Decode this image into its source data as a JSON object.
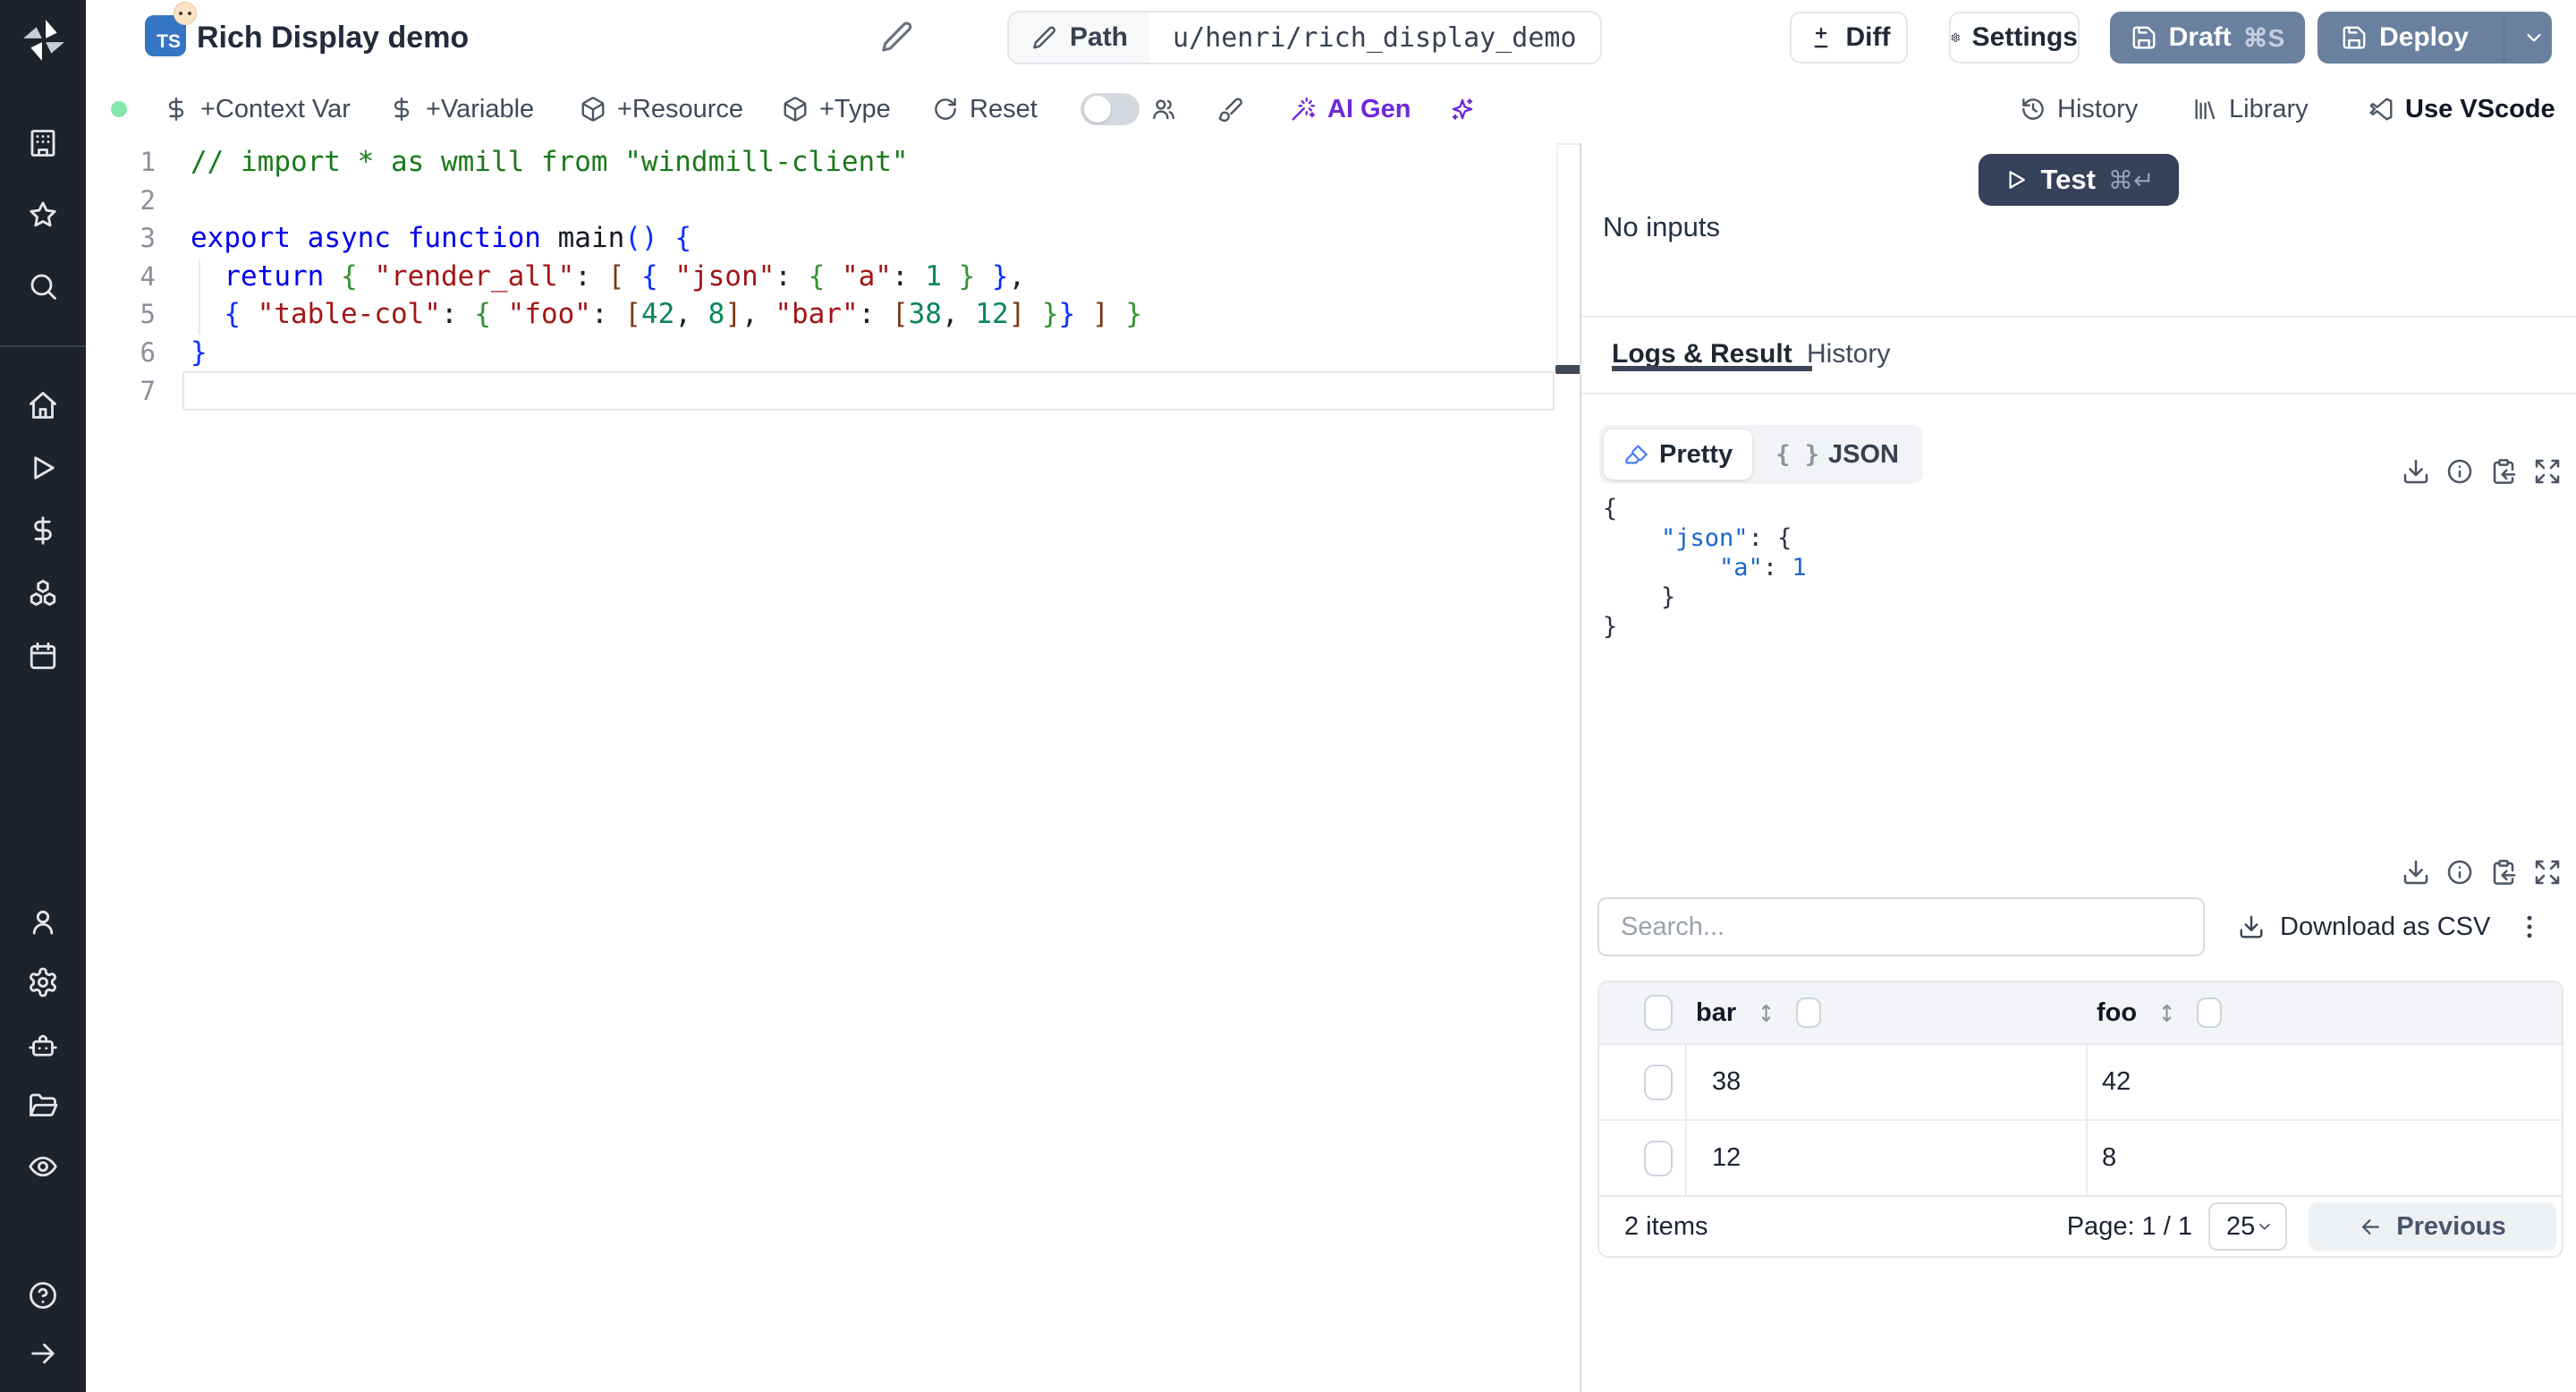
{
  "sidebar": {
    "icons": [
      "windmill-logo",
      "building",
      "star",
      "search",
      "home",
      "play",
      "dollar",
      "boxes",
      "calendar",
      "user",
      "settings",
      "bot",
      "folder-open",
      "eye",
      "help",
      "arrow-right"
    ]
  },
  "header": {
    "language_badge": "TS",
    "title": "Rich Display demo",
    "path_label": "Path",
    "path_value": "u/henri/rich_display_demo",
    "diff_label": "Diff",
    "settings_label": "Settings",
    "draft_label": "Draft",
    "draft_kbd": "⌘S",
    "deploy_label": "Deploy"
  },
  "toolbar": {
    "context_var": "+Context Var",
    "variable": "+Variable",
    "resource": "+Resource",
    "type": "+Type",
    "reset": "Reset",
    "ai_gen": "AI Gen",
    "history": "History",
    "library": "Library",
    "vscode": "Use VScode"
  },
  "editor": {
    "lines": [
      {
        "num": "1",
        "tokens": [
          {
            "t": "// import * as wmill from \"windmill-client\"",
            "c": "comment"
          }
        ]
      },
      {
        "num": "2",
        "tokens": []
      },
      {
        "num": "3",
        "tokens": [
          {
            "t": "export",
            "c": "kw"
          },
          {
            "t": " "
          },
          {
            "t": "async",
            "c": "kw"
          },
          {
            "t": " "
          },
          {
            "t": "function",
            "c": "kw"
          },
          {
            "t": " "
          },
          {
            "t": "main",
            "c": "fn"
          },
          {
            "t": "(",
            "c": "b1"
          },
          {
            "t": ")",
            "c": "b1"
          },
          {
            "t": " "
          },
          {
            "t": "{",
            "c": "b1"
          }
        ]
      },
      {
        "num": "4",
        "tokens": [
          {
            "t": "  "
          },
          {
            "t": "return",
            "c": "kw"
          },
          {
            "t": " "
          },
          {
            "t": "{",
            "c": "b2"
          },
          {
            "t": " "
          },
          {
            "t": "\"render_all\"",
            "c": "str"
          },
          {
            "t": ": "
          },
          {
            "t": "[",
            "c": "b3"
          },
          {
            "t": " "
          },
          {
            "t": "{",
            "c": "b1"
          },
          {
            "t": " "
          },
          {
            "t": "\"json\"",
            "c": "str"
          },
          {
            "t": ": "
          },
          {
            "t": "{",
            "c": "b2"
          },
          {
            "t": " "
          },
          {
            "t": "\"a\"",
            "c": "str"
          },
          {
            "t": ": "
          },
          {
            "t": "1",
            "c": "num"
          },
          {
            "t": " "
          },
          {
            "t": "}",
            "c": "b2"
          },
          {
            "t": " "
          },
          {
            "t": "}",
            "c": "b1"
          },
          {
            "t": ","
          }
        ]
      },
      {
        "num": "5",
        "tokens": [
          {
            "t": "  "
          },
          {
            "t": "{",
            "c": "b1"
          },
          {
            "t": " "
          },
          {
            "t": "\"table-col\"",
            "c": "str"
          },
          {
            "t": ": "
          },
          {
            "t": "{",
            "c": "b2"
          },
          {
            "t": " "
          },
          {
            "t": "\"foo\"",
            "c": "str"
          },
          {
            "t": ": "
          },
          {
            "t": "[",
            "c": "b3"
          },
          {
            "t": "42",
            "c": "num"
          },
          {
            "t": ", "
          },
          {
            "t": "8",
            "c": "num"
          },
          {
            "t": "]",
            "c": "b3"
          },
          {
            "t": ", "
          },
          {
            "t": "\"bar\"",
            "c": "str"
          },
          {
            "t": ": "
          },
          {
            "t": "[",
            "c": "b3"
          },
          {
            "t": "38",
            "c": "num"
          },
          {
            "t": ", "
          },
          {
            "t": "12",
            "c": "num"
          },
          {
            "t": "]",
            "c": "b3"
          },
          {
            "t": " "
          },
          {
            "t": "}",
            "c": "b2"
          },
          {
            "t": "}",
            "c": "b1"
          },
          {
            "t": " "
          },
          {
            "t": "]",
            "c": "b3"
          },
          {
            "t": " "
          },
          {
            "t": "}",
            "c": "b2"
          }
        ]
      },
      {
        "num": "6",
        "tokens": [
          {
            "t": "}",
            "c": "b1"
          }
        ]
      },
      {
        "num": "7",
        "tokens": []
      }
    ]
  },
  "run": {
    "test_label": "Test",
    "test_kbd": "⌘↵",
    "no_inputs": "No inputs"
  },
  "tabs": {
    "logs_result": "Logs & Result",
    "history": "History"
  },
  "result": {
    "pretty_label": "Pretty",
    "json_label": "JSON",
    "braces_glyph": "{ }",
    "json_lines": [
      [
        {
          "t": "{",
          "c": "jp"
        }
      ],
      [
        {
          "t": "    ",
          "c": "jp"
        },
        {
          "t": "\"json\"",
          "c": "jk"
        },
        {
          "t": ": ",
          "c": "jp"
        },
        {
          "t": "{",
          "c": "jp"
        }
      ],
      [
        {
          "t": "        ",
          "c": "jp"
        },
        {
          "t": "\"a\"",
          "c": "jk"
        },
        {
          "t": ": ",
          "c": "jp"
        },
        {
          "t": "1",
          "c": "jk"
        }
      ],
      [
        {
          "t": "    ",
          "c": "jp"
        },
        {
          "t": "}",
          "c": "jp"
        }
      ],
      [
        {
          "t": "}",
          "c": "jp"
        }
      ]
    ]
  },
  "table": {
    "search_placeholder": "Search...",
    "download_csv": "Download as CSV",
    "columns": [
      "bar",
      "foo"
    ],
    "rows": [
      [
        "38",
        "42"
      ],
      [
        "12",
        "8"
      ]
    ],
    "items_text": "2 items",
    "page_text": "Page: 1 / 1",
    "page_size": "25",
    "previous_label": "Previous"
  },
  "colors": {
    "accent_slate_button": "#69809e",
    "test_button": "#36415a",
    "sidebar_bg": "#1e222b",
    "ai_purple": "#6d28d9",
    "status_dot_green": "#86e7ad",
    "ts_badge_blue": "#3575c4"
  }
}
